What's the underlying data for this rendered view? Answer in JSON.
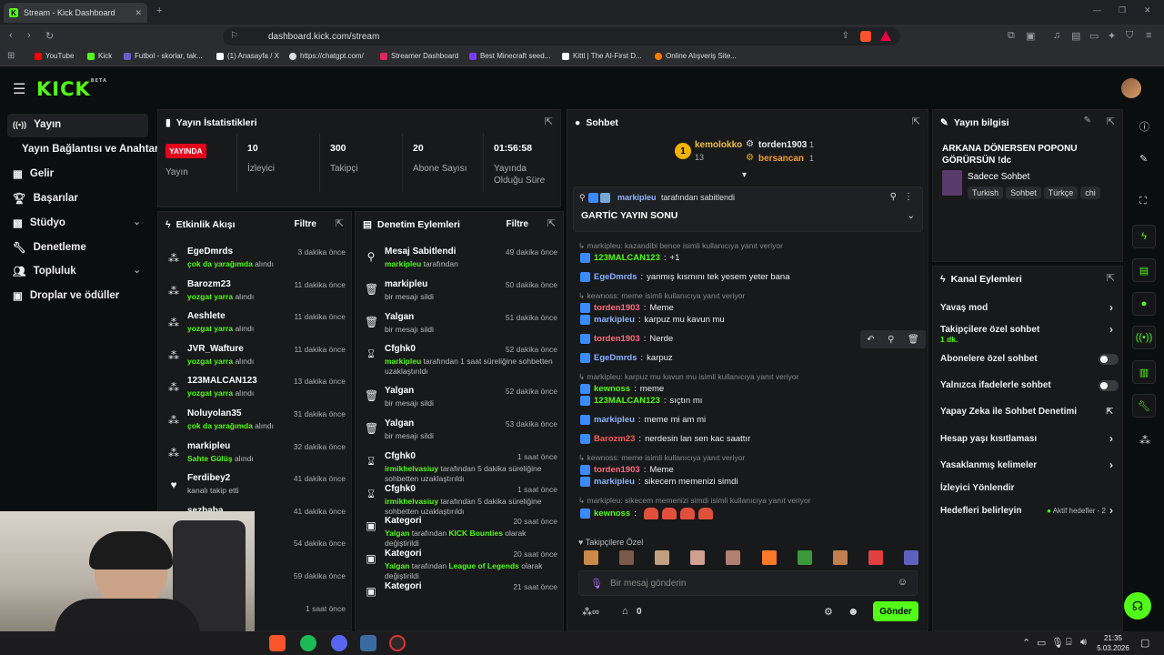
{
  "browser": {
    "tab_title": "Stream - Kick Dashboard",
    "url": "dashboard.kick.com/stream",
    "bookmarks": [
      {
        "label": "YouTube",
        "color": "#ff0000"
      },
      {
        "label": "Kick",
        "color": "#53fc18"
      },
      {
        "label": "Futbol - skorlar, tak...",
        "color": "#6a5acd"
      },
      {
        "label": "(1) Anasayfa / X",
        "color": "#ffffff"
      },
      {
        "label": "https://chatgpt.com/",
        "color": "#dddddd"
      },
      {
        "label": "Streamer Dashboard",
        "color": "#e0245e"
      },
      {
        "label": "Best Minecraft seed...",
        "color": "#7a3cff"
      },
      {
        "label": "Kittl | The AI-First D...",
        "color": "#ffffff"
      },
      {
        "label": "Online Alışveriş Site...",
        "color": "#ff7a00"
      }
    ]
  },
  "app": {
    "logo": "KICK",
    "logo_badge": "BETA",
    "accent": "#53fc18",
    "nav": [
      {
        "label": "Yayın",
        "icon": "broadcast-icon",
        "active": true
      },
      {
        "label": "Yayın Bağlantısı ve Anahtarı",
        "icon": ""
      },
      {
        "label": "Gelir",
        "icon": "chart-icon"
      },
      {
        "label": "Başarılar",
        "icon": "trophy-icon"
      },
      {
        "label": "Stüdyo",
        "icon": "grid-icon"
      },
      {
        "label": "Denetleme",
        "icon": "wrench-icon"
      },
      {
        "label": "Topluluk",
        "icon": "users-icon"
      },
      {
        "label": "Droplar ve ödüller",
        "icon": "gift-icon"
      }
    ]
  },
  "stats": {
    "title": "Yayın İstatistikleri",
    "live_badge": "YAYINDA",
    "live_label": "Yayın",
    "items": [
      {
        "value": "10",
        "label": "İzleyici"
      },
      {
        "value": "300",
        "label": "Takipçi"
      },
      {
        "value": "20",
        "label": "Abone Sayısı"
      },
      {
        "value": "01:56:58",
        "label": "Yayında Olduğu Süre"
      }
    ]
  },
  "activity": {
    "title": "Etkinlik Akışı",
    "filter": "Filtre",
    "items": [
      {
        "name": "EgeDmrds",
        "time": "3 dakika önce",
        "highlight": "çok da yarağımda",
        "rest": " alındı",
        "icon": "gift-icon"
      },
      {
        "name": "Barozm23",
        "time": "11 dakika önce",
        "highlight": "yozgat yarra",
        "rest": " alındı",
        "icon": "gift-icon"
      },
      {
        "name": "Aeshlete",
        "time": "11 dakika önce",
        "highlight": "yozgat yarra",
        "rest": " alındı",
        "icon": "gift-icon"
      },
      {
        "name": "JVR_Wafture",
        "time": "11 dakika önce",
        "highlight": "yozgat yarra",
        "rest": " alındı",
        "icon": "gift-icon"
      },
      {
        "name": "123MALCAN123",
        "time": "13 dakika önce",
        "highlight": "yozgat yarra",
        "rest": " alındı",
        "icon": "gift-icon"
      },
      {
        "name": "Noluyolan35",
        "time": "31 dakika önce",
        "highlight": "çok da yarağımda",
        "rest": " alındı",
        "icon": "gift-icon"
      },
      {
        "name": "markipleu",
        "time": "32 dakika önce",
        "highlight": "Sahte Gülüş",
        "rest": " alındı",
        "icon": "gift-icon"
      },
      {
        "name": "Ferdibey2",
        "time": "41 dakika önce",
        "highlight": "",
        "rest": "kanalı takip etti",
        "icon": "heart-icon"
      },
      {
        "name": "sezbaba",
        "time": "41 dakika önce",
        "highlight": "",
        "rest": "",
        "icon": "heart-icon"
      },
      {
        "name": "",
        "time": "54 dakika önce",
        "highlight": "",
        "rest": "",
        "icon": ""
      },
      {
        "name": "",
        "time": "59 dakika önce",
        "highlight": "",
        "rest": "",
        "icon": ""
      },
      {
        "name": "",
        "time": "1 saat önce",
        "highlight": "",
        "rest": "",
        "icon": ""
      }
    ]
  },
  "moderation": {
    "title": "Denetim Eylemleri",
    "filter": "Filtre",
    "items": [
      {
        "name": "Mesaj Sabitlendi",
        "time": "49 dakika önce",
        "pre": "",
        "highlight": "markipleu",
        "rest": " tarafından",
        "icon": "pin-icon"
      },
      {
        "name": "markipleu",
        "time": "50 dakika önce",
        "pre": "",
        "highlight": "",
        "rest": "bir mesajı sildi",
        "icon": "trash-icon"
      },
      {
        "name": "Yalgan",
        "time": "51 dakika önce",
        "pre": "",
        "highlight": "",
        "rest": "bir mesajı sildi",
        "icon": "trash-icon"
      },
      {
        "name": "Cfghk0",
        "time": "52 dakika önce",
        "pre": "",
        "highlight": "markipleu",
        "rest": " tarafından 1 saat süreliğine sohbetten uzaklaştırıldı",
        "icon": "hourglass-icon"
      },
      {
        "name": "Yalgan",
        "time": "52 dakika önce",
        "pre": "",
        "highlight": "",
        "rest": "bir mesajı sildi",
        "icon": "trash-icon"
      },
      {
        "name": "Yalgan",
        "time": "53 dakika önce",
        "pre": "",
        "highlight": "",
        "rest": "bir mesajı sildi",
        "icon": "trash-icon"
      },
      {
        "name": "Cfghk0",
        "time": "1 saat önce",
        "pre": "",
        "highlight": "irmikhelvasiuy",
        "rest": " tarafından 5 dakika süreliğine sohbetten uzaklaştırıldı",
        "icon": "hourglass-icon"
      },
      {
        "name": "Cfghk0",
        "time": "1 saat önce",
        "pre": "",
        "highlight": "irmikhelvasiuy",
        "rest": " tarafından 5 dakika süreliğine sohbetten uzaklaştırıldı",
        "icon": "hourglass-icon"
      },
      {
        "name": "Kategori",
        "time": "20 saat önce",
        "pre": "Yalgan",
        "highlight": "KICK Bounties",
        "rest": " olarak değiştirildi",
        "icon": "category-icon"
      },
      {
        "name": "Kategori",
        "time": "20 saat önce",
        "pre": "Yalgan",
        "highlight": "League of Legends",
        "rest": " olarak değiştirildi",
        "icon": "category-icon"
      },
      {
        "name": "Kategori",
        "time": "21 saat önce",
        "pre": "",
        "highlight": "",
        "rest": "",
        "icon": "category-icon"
      }
    ]
  },
  "chat": {
    "title": "Sohbet",
    "top": [
      {
        "name": "kemolokko",
        "count": "13"
      },
      {
        "name": "torden1903",
        "count": "1"
      },
      {
        "name": "bersancan",
        "count": "1"
      }
    ],
    "pinned": {
      "by": "markipleu",
      "by_suffix": "tarafından sabitlendi",
      "text": "GARTİC YAYIN SONU"
    },
    "messages": [
      {
        "reply": "markipleu: kazandibi bence isimli kullanıcıya yanıt veriyor",
        "user": "",
        "color": "",
        "text": ""
      },
      {
        "reply": "",
        "user": "123MALCAN123",
        "color": "#53fc18",
        "text": "+1"
      },
      {
        "reply": "",
        "user": "EgeDmrds",
        "color": "#8ab4ff",
        "text": "yanmış kısmını tek yesem yeter bana"
      },
      {
        "reply": "kewnoss: meme isimli kullanıcıya yanıt veriyor",
        "user": "torden1903",
        "color": "#ff6b81",
        "text": "Meme"
      },
      {
        "reply": "",
        "user": "markipleu",
        "color": "#8ab4ff",
        "text": "karpuz mu kavun mu"
      },
      {
        "reply": "",
        "user": "torden1903",
        "color": "#ff6b81",
        "text": "Nerde"
      },
      {
        "reply": "",
        "user": "EgeDmrds",
        "color": "#8ab4ff",
        "text": "karpuz"
      },
      {
        "reply": "markipleu: karpuz mu kavun mu isimli kullanıcıya yanıt veriyor",
        "user": "kewnoss",
        "color": "#53fc18",
        "text": "meme"
      },
      {
        "reply": "",
        "user": "123MALCAN123",
        "color": "#53fc18",
        "text": "sıçtın mı"
      },
      {
        "reply": "",
        "user": "markipleu",
        "color": "#8ab4ff",
        "text": "meme mi am mi"
      },
      {
        "reply": "",
        "user": "Barozm23",
        "color": "#ff5a5a",
        "text": "nerdesin lan sen kac saattır"
      },
      {
        "reply": "kewnoss: meme isimli kullanıcıya yanıt veriyor",
        "user": "torden1903",
        "color": "#ff6b81",
        "text": "Meme"
      },
      {
        "reply": "",
        "user": "markipleu",
        "color": "#8ab4ff",
        "text": "sikecem memenizi simdi"
      },
      {
        "reply": "markipleu: sikecem memenizi simdi isimli kullanıcıya yanıt veriyor",
        "user": "kewnoss",
        "color": "#53fc18",
        "text": ""
      }
    ],
    "emote_section": "Takipçilere Özel",
    "input_placeholder": "Bir mesaj gönderin",
    "points": "0",
    "send": "Gönder"
  },
  "stream_info": {
    "title": "Yayın bilgisi",
    "stream_title": "ARKANA DÖNERSEN POPONU GÖRÜRSÜN !dc",
    "category": "Sadece Sohbet",
    "tags": [
      "Turkish",
      "Sohbet",
      "Türkçe",
      "chi"
    ]
  },
  "channel_actions": {
    "title": "Kanal Eylemleri",
    "items": [
      {
        "label": "Yavaş mod",
        "sub": "",
        "control": "chevron"
      },
      {
        "label": "Takipçilere özel sohbet",
        "sub": "1 dk.",
        "control": "chevron"
      },
      {
        "label": "Abonelere özel sohbet",
        "sub": "",
        "control": "toggle"
      },
      {
        "label": "Yalnızca ifadelerle sohbet",
        "sub": "",
        "control": "toggle"
      },
      {
        "label": "Yapay Zeka ile Sohbet Denetimi",
        "sub": "",
        "control": "external"
      },
      {
        "label": "Hesap yaşı kısıtlaması",
        "sub": "",
        "control": "chevron"
      },
      {
        "label": "Yasaklanmış kelimeler",
        "sub": "",
        "control": "chevron"
      },
      {
        "label": "İzleyici Yönlendir",
        "sub": "",
        "control": ""
      },
      {
        "label": "Hedefleri belirleyin",
        "sub": "",
        "control": "goals"
      }
    ],
    "goals_label": "Aktif hedefler - 2"
  },
  "taskbar": {
    "time": "21:35",
    "date": "5.03.2026"
  }
}
